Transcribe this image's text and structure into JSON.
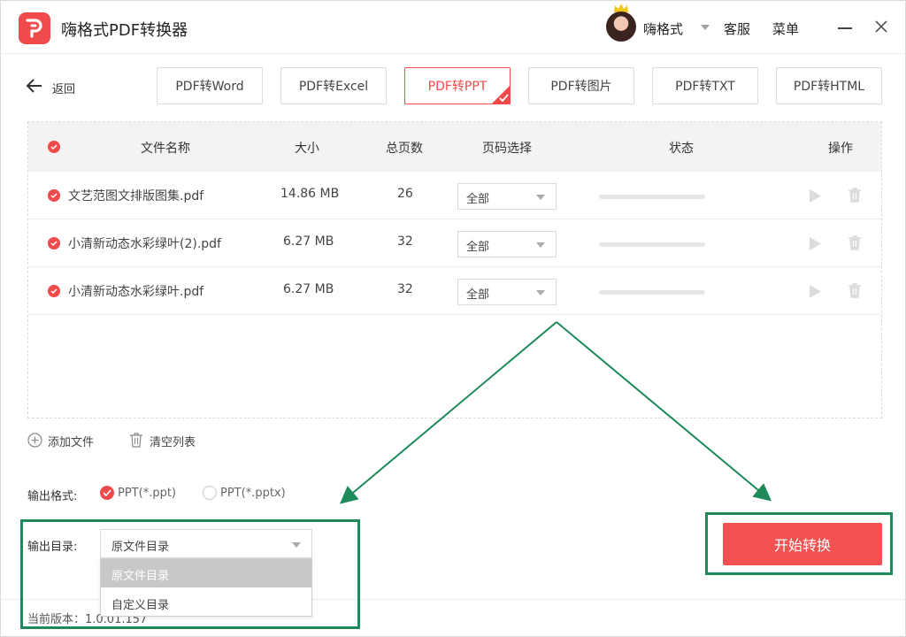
{
  "app": {
    "title": "嗨格式PDF转换器",
    "user_name": "嗨格式",
    "service_label": "客服",
    "menu_label": "菜单"
  },
  "nav": {
    "back_label": "返回",
    "tabs": [
      "PDF转Word",
      "PDF转Excel",
      "PDF转PPT",
      "PDF转图片",
      "PDF转TXT",
      "PDF转HTML"
    ],
    "active_tab": "PDF转PPT"
  },
  "table": {
    "headers": {
      "name": "文件名称",
      "size": "大小",
      "pages": "总页数",
      "page_select": "页码选择",
      "status": "状态",
      "actions": "操作"
    },
    "rows": [
      {
        "name": "文艺范图文排版图集.pdf",
        "size": "14.86 MB",
        "pages": "26",
        "page_select": "全部",
        "progress": 0
      },
      {
        "name": "小清新动态水彩绿叶(2).pdf",
        "size": "6.27 MB",
        "pages": "32",
        "page_select": "全部",
        "progress": 0
      },
      {
        "name": "小清新动态水彩绿叶.pdf",
        "size": "6.27 MB",
        "pages": "32",
        "page_select": "全部",
        "progress": 0
      }
    ]
  },
  "actions": {
    "add_file": "添加文件",
    "clear_list": "清空列表"
  },
  "output": {
    "format_label": "输出格式:",
    "format_options": [
      "PPT(*.ppt)",
      "PPT(*.pptx)"
    ],
    "format_selected": "PPT(*.ppt)",
    "dir_label": "输出目录:",
    "dir_value": "原文件目录",
    "dir_options": [
      "原文件目录",
      "自定义目录"
    ]
  },
  "start_button": "开始转换",
  "version_text": "当前版本：1.0.01.157",
  "colors": {
    "accent": "#f04a4a",
    "annotation": "#1e8a5a"
  }
}
